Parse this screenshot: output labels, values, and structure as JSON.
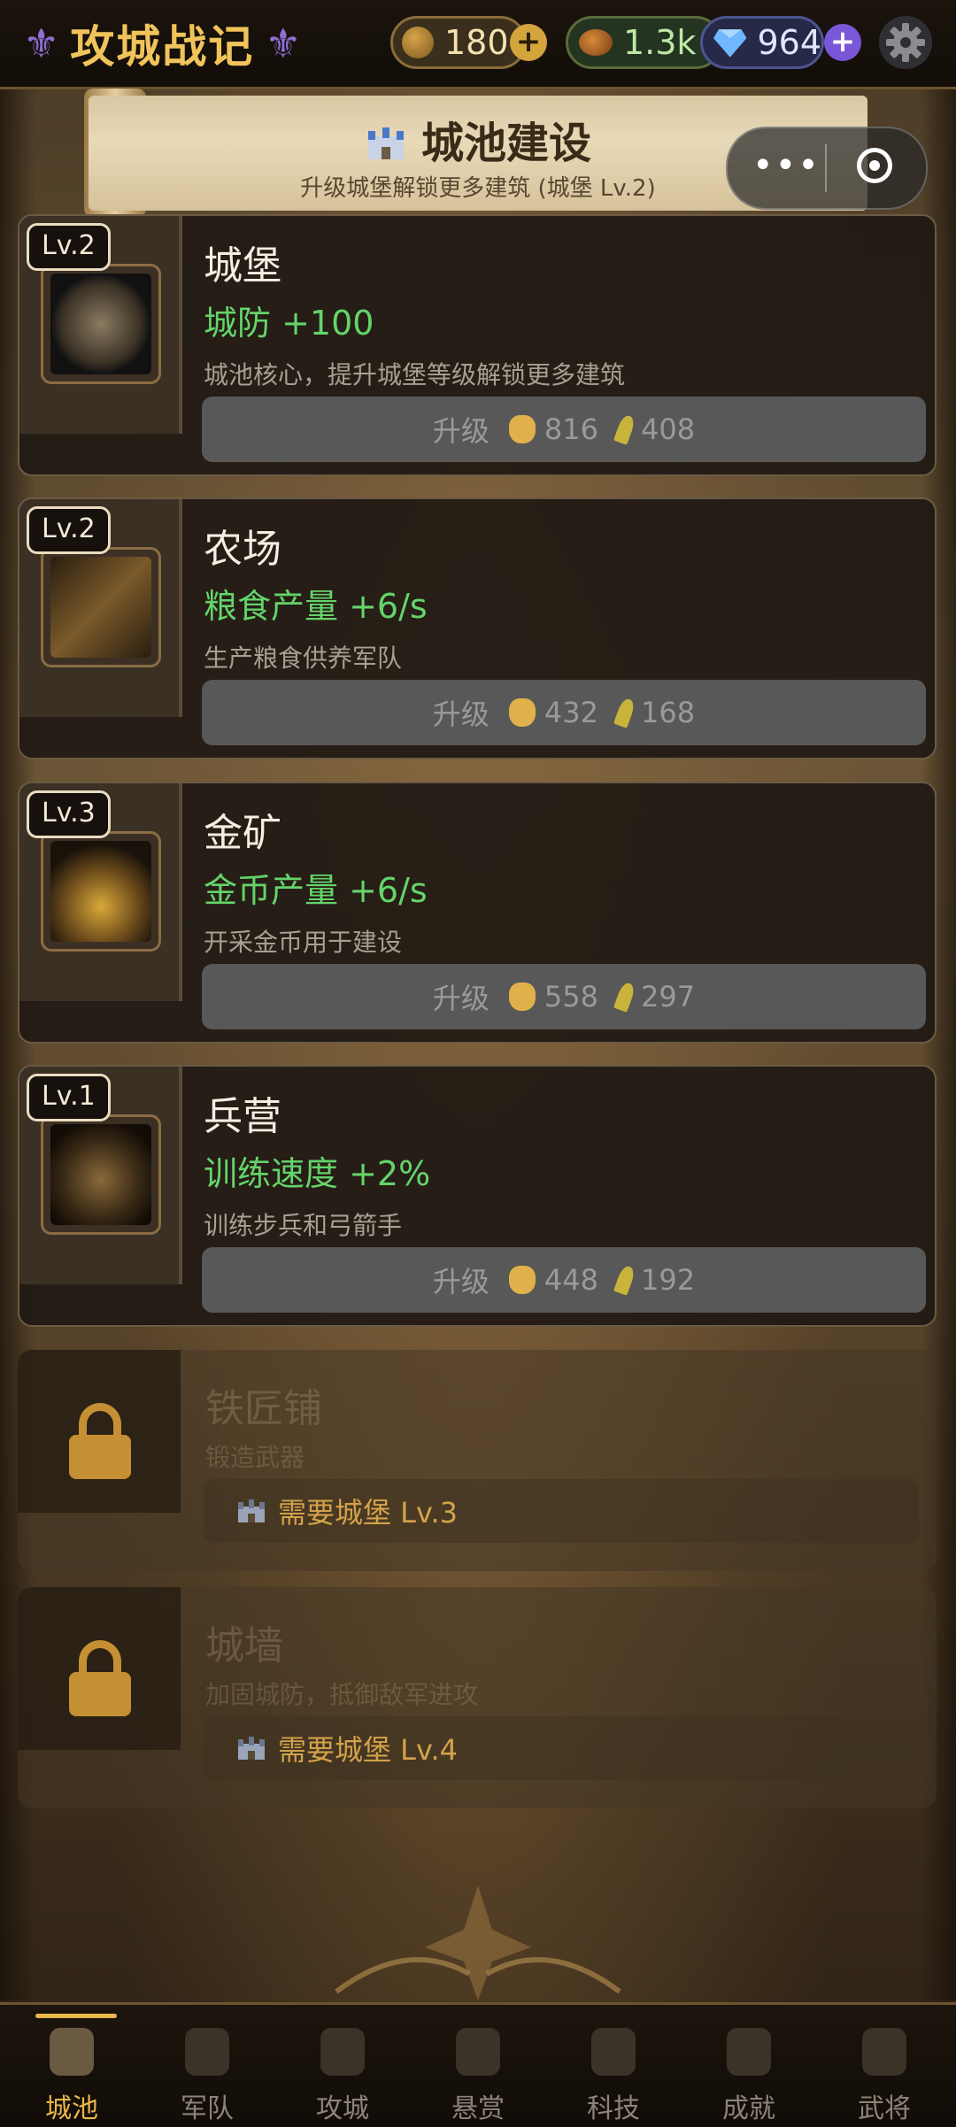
{
  "header": {
    "app_title": "攻城战记",
    "resources": {
      "gold": "180",
      "food": "1.3k",
      "gems": "964"
    }
  },
  "page": {
    "title": "城池建设",
    "subtitle": "升级城堡解锁更多建筑 (城堡 Lv.2)"
  },
  "buildings": [
    {
      "level": "Lv.2",
      "name": "城堡",
      "effect": "城防 +100",
      "desc": "城池核心，提升城堡等级解锁更多建筑",
      "upgrade_label": "升级",
      "gold_cost": "816",
      "food_cost": "408"
    },
    {
      "level": "Lv.2",
      "name": "农场",
      "effect": "粮食产量 +6/s",
      "desc": "生产粮食供养军队",
      "upgrade_label": "升级",
      "gold_cost": "432",
      "food_cost": "168"
    },
    {
      "level": "Lv.3",
      "name": "金矿",
      "effect": "金币产量 +6/s",
      "desc": "开采金币用于建设",
      "upgrade_label": "升级",
      "gold_cost": "558",
      "food_cost": "297"
    },
    {
      "level": "Lv.1",
      "name": "兵营",
      "effect": "训练速度 +2%",
      "desc": "训练步兵和弓箭手",
      "upgrade_label": "升级",
      "gold_cost": "448",
      "food_cost": "192"
    }
  ],
  "locked_buildings": [
    {
      "name": "铁匠铺",
      "desc": "锻造武器",
      "requirement": "需要城堡 Lv.3"
    },
    {
      "name": "城墙",
      "desc": "加固城防，抵御敌军进攻",
      "requirement": "需要城堡 Lv.4"
    }
  ],
  "tabs": [
    {
      "label": "城池",
      "icon": "castle-icon",
      "active": true
    },
    {
      "label": "军队",
      "icon": "crossed-swords-icon",
      "active": false
    },
    {
      "label": "攻城",
      "icon": "siege-icon",
      "active": false
    },
    {
      "label": "悬赏",
      "icon": "bounty-icon",
      "active": false
    },
    {
      "label": "科技",
      "icon": "tech-icon",
      "active": false
    },
    {
      "label": "成就",
      "icon": "achievement-icon",
      "active": false
    },
    {
      "label": "武将",
      "icon": "general-icon",
      "active": false
    }
  ],
  "colors": {
    "accent_gold": "#e9b74a",
    "effect_green": "#64d46a",
    "requirement_orange": "#d3a24a"
  }
}
